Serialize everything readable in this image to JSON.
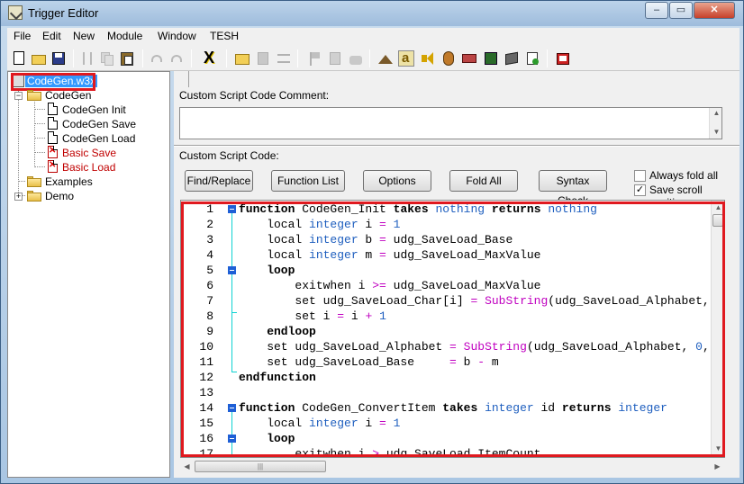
{
  "window": {
    "title": "Trigger Editor",
    "min": "‒",
    "max": "▭",
    "close": "✕"
  },
  "menu": [
    "File",
    "Edit",
    "New",
    "Module",
    "Window",
    "TESH"
  ],
  "tree": {
    "root": "CodeGen.w3x",
    "items": [
      {
        "label": "CodeGen"
      },
      {
        "label": "CodeGen Init"
      },
      {
        "label": "CodeGen Save"
      },
      {
        "label": "CodeGen Load"
      },
      {
        "label": "Basic Save"
      },
      {
        "label": "Basic Load"
      },
      {
        "label": "Examples"
      },
      {
        "label": "Demo"
      }
    ]
  },
  "panel": {
    "comment_label": "Custom Script Code Comment:",
    "code_label": "Custom Script Code:",
    "buttons": [
      "Find/Replace",
      "Function List",
      "Options",
      "Fold All",
      "Syntax Check"
    ],
    "always_fold": "Always fold all",
    "save_scroll": "Save scroll position",
    "always_fold_checked": false,
    "save_scroll_checked": true
  },
  "code_lines": [
    {
      "n": "1"
    },
    {
      "n": "2"
    },
    {
      "n": "3"
    },
    {
      "n": "4"
    },
    {
      "n": "5"
    },
    {
      "n": "6"
    },
    {
      "n": "7"
    },
    {
      "n": "8"
    },
    {
      "n": "9"
    },
    {
      "n": "10"
    },
    {
      "n": "11"
    },
    {
      "n": "12"
    },
    {
      "n": "13"
    },
    {
      "n": "14"
    },
    {
      "n": "15"
    },
    {
      "n": "16"
    },
    {
      "n": "17"
    }
  ],
  "code": {
    "l1": [
      "function",
      " CodeGen_Init ",
      "takes",
      " ",
      "nothing",
      " ",
      "returns",
      " ",
      "nothing"
    ],
    "l2": [
      "    local ",
      "integer",
      " i ",
      "=",
      " ",
      "1"
    ],
    "l3": [
      "    local ",
      "integer",
      " b ",
      "=",
      " udg_SaveLoad_Base"
    ],
    "l4": [
      "    local ",
      "integer",
      " m ",
      "=",
      " udg_SaveLoad_MaxValue"
    ],
    "l5": [
      "    loop"
    ],
    "l6": [
      "        exitwhen i ",
      ">=",
      " udg_SaveLoad_MaxValue"
    ],
    "l7": [
      "        set udg_SaveLoad_Char[i] ",
      "=",
      " ",
      "SubString",
      "(udg_SaveLoad_Alphabet,"
    ],
    "l8": [
      "        set i ",
      "=",
      " i ",
      "+",
      " ",
      "1"
    ],
    "l9": [
      "    endloop"
    ],
    "l10": [
      "    set udg_SaveLoad_Alphabet ",
      "=",
      " ",
      "SubString",
      "(udg_SaveLoad_Alphabet, ",
      "0",
      ","
    ],
    "l11": [
      "    set udg_SaveLoad_Base     ",
      "=",
      " b ",
      "-",
      " m"
    ],
    "l12": [
      "endfunction"
    ],
    "l13": [
      ""
    ],
    "l14": [
      "function",
      " CodeGen_ConvertItem ",
      "takes",
      " ",
      "integer",
      " id ",
      "returns",
      " ",
      "integer"
    ],
    "l15": [
      "    local ",
      "integer",
      " i ",
      "=",
      " ",
      "1"
    ],
    "l16": [
      "    loop"
    ],
    "l17": [
      "        exitwhen i ",
      ">",
      " udg_SaveLoad_ItemCount"
    ]
  },
  "colors": {
    "keyword": "#000000",
    "type": "#1f5fbf",
    "operator": "#c000c0",
    "highlight": "#e0191f"
  }
}
